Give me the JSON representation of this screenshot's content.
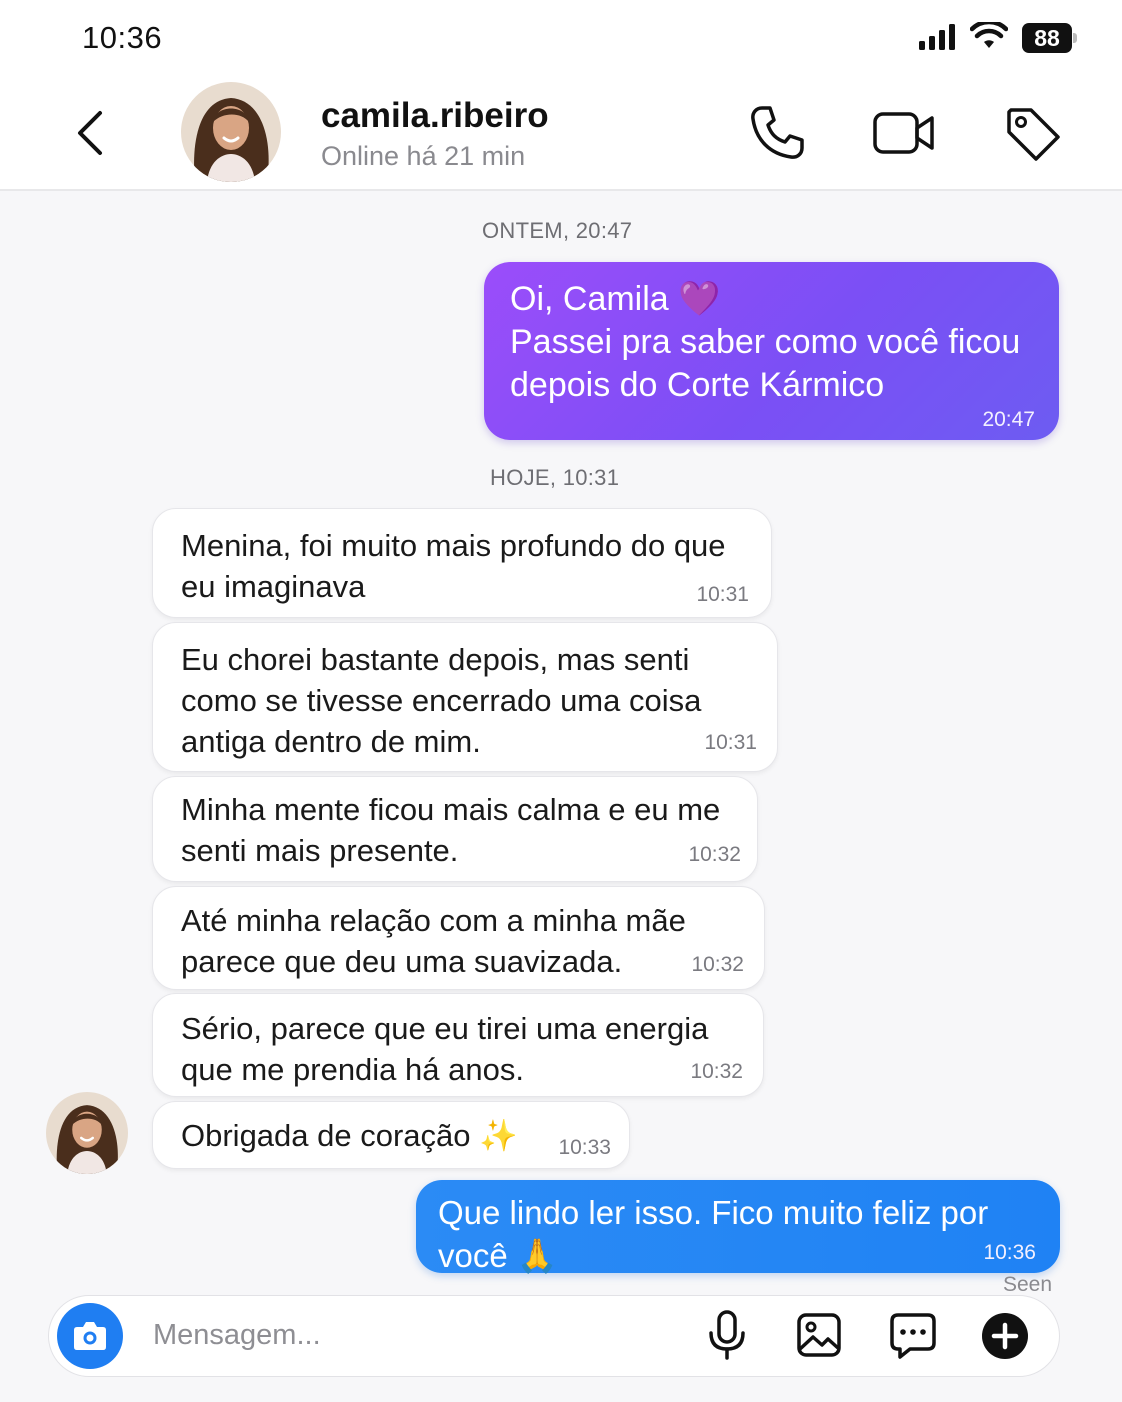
{
  "status_bar": {
    "time": "10:36",
    "battery": "88"
  },
  "header": {
    "name": "camila.ribeiro",
    "status": "Online há 21 min",
    "icons": [
      "back-icon",
      "phone-icon",
      "video-camera-icon",
      "tag-icon"
    ]
  },
  "conversation": {
    "separators": [
      "ONTEM, 20:47",
      "HOJE, 10:31"
    ],
    "outgoing_first": {
      "text": "Oi, Camila 💜\nPassei pra saber como você ficou\ndepois do Corte Kármico",
      "time": "20:47"
    },
    "incoming": [
      {
        "text": "Menina, foi muito mais profundo do que\neu imaginava",
        "time": "10:31"
      },
      {
        "text": "Eu chorei bastante depois, mas senti\ncomo se tivesse encerrado uma coisa\nantiga dentro de mim.",
        "time": "10:31"
      },
      {
        "text": "Minha mente ficou mais calma e eu me\nsenti mais presente.",
        "time": "10:32"
      },
      {
        "text": "Até minha relação com a minha mãe\nparece que deu uma suavizada.",
        "time": "10:32"
      },
      {
        "text": "Sério, parece que eu tirei uma energia\nque me prendia há anos.",
        "time": "10:32"
      },
      {
        "text": "Obrigada de coração ✨",
        "time": "10:33"
      }
    ],
    "outgoing_last": {
      "text": "Que lindo ler isso. Fico muito feliz por você 🙏",
      "time": "10:36"
    },
    "seen": "Seen"
  },
  "composer": {
    "placeholder": "Mensagem..."
  },
  "colors": {
    "outgoing_purple": "#7b4ff5",
    "outgoing_blue": "#1f82f4",
    "camera_button": "#1f7ef2"
  }
}
